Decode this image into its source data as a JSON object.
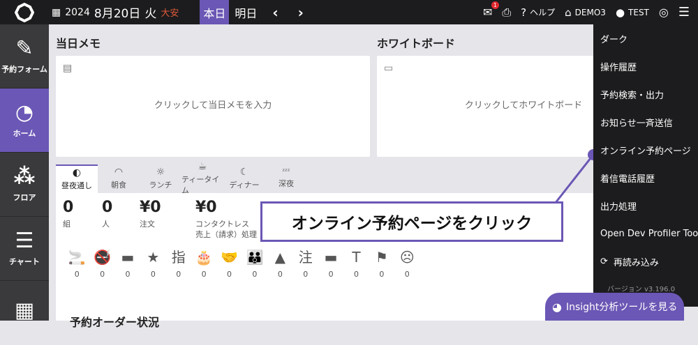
{
  "header": {
    "date": {
      "year": "2024",
      "monthday": "8月20日",
      "weekday": "火",
      "rokuyo": "大安"
    },
    "nav": {
      "today": "本日",
      "tomorrow": "明日"
    },
    "right": {
      "notification_count": "1",
      "help": "ヘルプ",
      "store": "DEMO3",
      "user": "TEST"
    }
  },
  "sidebar": {
    "items": [
      {
        "label": "予約フォーム",
        "icon": "edit-icon"
      },
      {
        "label": "ホーム",
        "icon": "dashboard-icon"
      },
      {
        "label": "フロア",
        "icon": "floor-icon"
      },
      {
        "label": "チャート",
        "icon": "chart-icon"
      },
      {
        "label": "",
        "icon": "table-icon"
      }
    ]
  },
  "memo": {
    "title": "当日メモ",
    "placeholder": "クリックして当日メモを入力"
  },
  "whiteboard": {
    "title": "ホワイトボード",
    "placeholder": "クリックしてホワイトボード"
  },
  "tabs": [
    {
      "label": "昼夜通し",
      "icon": "half-circle-icon"
    },
    {
      "label": "朝食",
      "icon": "sunrise-icon"
    },
    {
      "label": "ランチ",
      "icon": "sun-icon"
    },
    {
      "label": "ティータイム",
      "icon": "cup-icon"
    },
    {
      "label": "ディナー",
      "icon": "moon-icon"
    },
    {
      "label": "深夜",
      "icon": "zzz-icon"
    }
  ],
  "stats": [
    {
      "value": "0",
      "label": "組"
    },
    {
      "value": "0",
      "label": "人"
    },
    {
      "value": "¥0",
      "label": "注文"
    },
    {
      "value": "¥0",
      "label": "コンタクトレス\n売上（請求）処理"
    }
  ],
  "status_icons": [
    {
      "icon": "smoking-icon",
      "glyph": "🚬",
      "count": "0"
    },
    {
      "icon": "no-smoking-icon",
      "glyph": "🚭",
      "count": "0"
    },
    {
      "icon": "card-icon",
      "glyph": "▬",
      "count": "0"
    },
    {
      "icon": "star-icon",
      "glyph": "★",
      "count": "0"
    },
    {
      "icon": "kanji-shi-icon",
      "glyph": "指",
      "count": "0"
    },
    {
      "icon": "cake-icon",
      "glyph": "🎂",
      "count": "0"
    },
    {
      "icon": "handshake-icon",
      "glyph": "🤝",
      "count": "0"
    },
    {
      "icon": "group-icon",
      "glyph": "👪",
      "count": "0"
    },
    {
      "icon": "warning-icon",
      "glyph": "▲",
      "count": "0"
    },
    {
      "icon": "kanji-chu-icon",
      "glyph": "注",
      "count": "0"
    },
    {
      "icon": "dash-icon",
      "glyph": "▬",
      "count": "0"
    },
    {
      "icon": "t-icon",
      "glyph": "T",
      "count": "0"
    },
    {
      "icon": "flag-icon",
      "glyph": "⚑",
      "count": "0"
    },
    {
      "icon": "dizzy-face-icon",
      "glyph": "☹",
      "count": "0"
    }
  ],
  "order_section_title": "予約オーダー状況",
  "callout": "オンライン予約ページをクリック",
  "menu": {
    "items": [
      "ダーク",
      "操作履歴",
      "予約検索・出力",
      "お知らせ一斉送信",
      "オンライン予約ページ",
      "着信電話履歴",
      "出力処理",
      "Open Dev Profiler Tool"
    ],
    "reload": "再読み込み",
    "version": "バージョン v3.196.0"
  },
  "insight": {
    "label": "Insight分析ツールを見る"
  },
  "colors": {
    "accent": "#6b57b5",
    "topbar": "#1c1c1e",
    "sidebar": "#3a3a3c",
    "rokuyo": "#e05a3a",
    "badge": "#e0282e"
  }
}
